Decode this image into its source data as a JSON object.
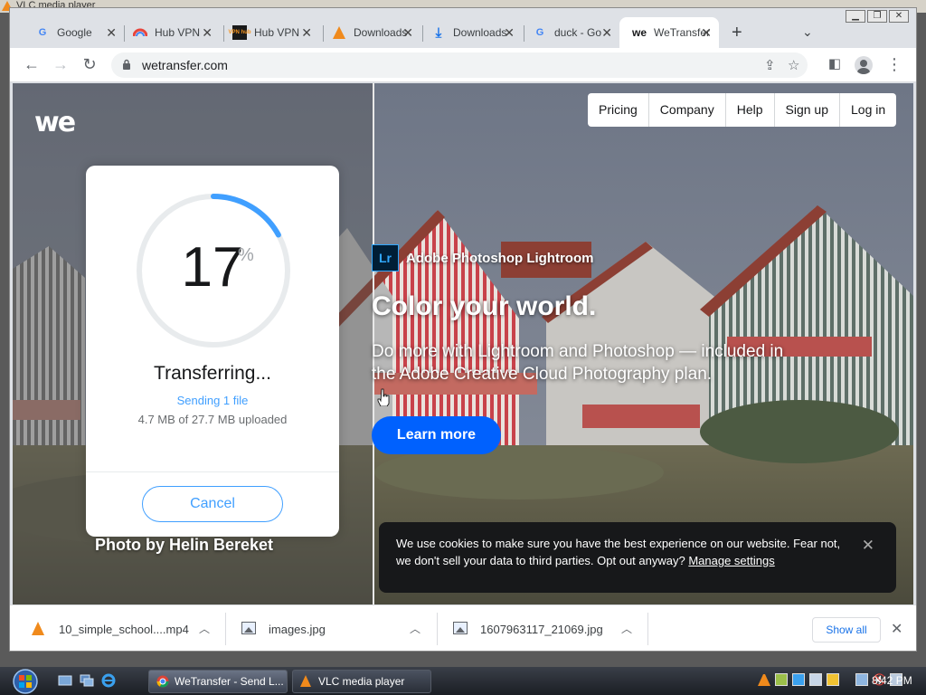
{
  "background_window": {
    "title": "VLC media player"
  },
  "tabs": [
    {
      "label": "Google",
      "icon": "google-icon"
    },
    {
      "label": "Hub VPN",
      "icon": "hub-vpn-icon"
    },
    {
      "label": "Hub VPN",
      "icon": "hub-vpn-logo-icon"
    },
    {
      "label": "Downloads",
      "icon": "vlc-icon"
    },
    {
      "label": "Downloads",
      "icon": "download-icon"
    },
    {
      "label": "duck - Go",
      "icon": "google-icon"
    },
    {
      "label": "WeTransfer",
      "icon": "wetransfer-icon",
      "active": true
    }
  ],
  "toolbar": {
    "url": "wetransfer.com"
  },
  "page": {
    "logo": "we",
    "nav": [
      "Pricing",
      "Company",
      "Help",
      "Sign up",
      "Log in"
    ],
    "transfer": {
      "percent": "17",
      "percent_symbol": "%",
      "progress_fraction": 0.17,
      "title": "Transferring...",
      "subtitle": "Sending 1 file",
      "size": "4.7 MB of 27.7 MB uploaded",
      "cancel_label": "Cancel"
    },
    "photo_credit": "Photo by Helin Bereket",
    "ad": {
      "brand_icon": "Lr",
      "brand": "Adobe Photoshop Lightroom",
      "headline": "Color your world.",
      "body": "Do more with Lightroom and Photoshop — included in the Adobe Creative Cloud Photography plan.",
      "cta": "Learn more"
    },
    "cookie": {
      "text": "We use cookies to make sure you have the best experience on our website. Fear not, we don't sell your data to third parties. Opt out anyway?",
      "link": "Manage settings"
    }
  },
  "downloads": {
    "items": [
      {
        "name": "10_simple_school....mp4",
        "icon": "vlc-file-icon"
      },
      {
        "name": "images.jpg",
        "icon": "image-file-icon"
      },
      {
        "name": "1607963117_21069.jpg",
        "icon": "image-file-icon"
      }
    ],
    "show_all": "Show all"
  },
  "taskbar": {
    "tasks": [
      {
        "label": "WeTransfer - Send L...",
        "active": true
      },
      {
        "label": "VLC media player",
        "active": false
      }
    ],
    "clock": "8:42 PM"
  },
  "colors": {
    "accent_blue": "#409fff",
    "cta_blue": "#0061fe",
    "progress_track": "#e8ebed",
    "cookie_bg": "#17181a"
  }
}
